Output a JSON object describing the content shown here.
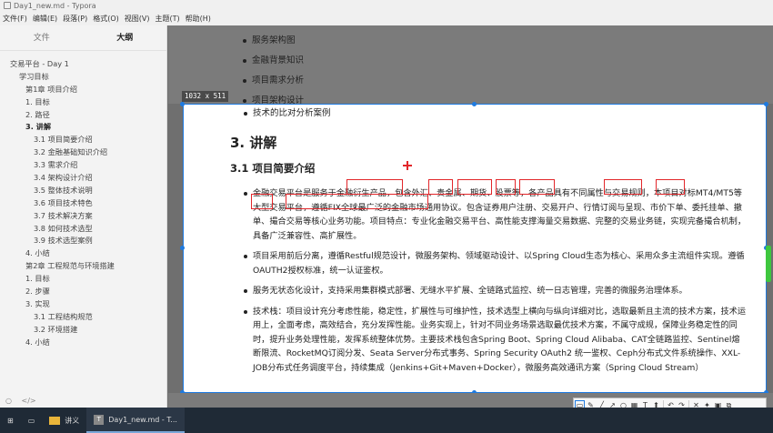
{
  "window": {
    "title": "Day1_new.md - Typora"
  },
  "menu": [
    "文件(F)",
    "编辑(E)",
    "段落(P)",
    "格式(O)",
    "视图(V)",
    "主题(T)",
    "帮助(H)"
  ],
  "sidebar": {
    "tabs": [
      "文件",
      "大纲"
    ],
    "active_tab": "大纲",
    "outline": [
      {
        "label": "交易平台 - Day 1",
        "level": 0
      },
      {
        "label": "学习目标",
        "level": 1
      },
      {
        "label": "第1章 项目介绍",
        "level": 2
      },
      {
        "label": "1. 目标",
        "level": 2
      },
      {
        "label": "2. 路径",
        "level": 2
      },
      {
        "label": "3. 讲解",
        "level": 2,
        "bold": true
      },
      {
        "label": "3.1 项目简要介绍",
        "level": 3
      },
      {
        "label": "3.2 金融基础知识介绍",
        "level": 3
      },
      {
        "label": "3.3 需求介绍",
        "level": 3
      },
      {
        "label": "3.4 架构设计介绍",
        "level": 3
      },
      {
        "label": "3.5 整体技术说明",
        "level": 3
      },
      {
        "label": "3.6 项目技术特色",
        "level": 3
      },
      {
        "label": "3.7 技术解决方案",
        "level": 3
      },
      {
        "label": "3.8 如何技术选型",
        "level": 3
      },
      {
        "label": "3.9 技术选型案例",
        "level": 3
      },
      {
        "label": "4. 小结",
        "level": 2
      },
      {
        "label": "第2章 工程规范与环境搭建",
        "level": 2
      },
      {
        "label": "1. 目标",
        "level": 2
      },
      {
        "label": "2. 步骤",
        "level": 2
      },
      {
        "label": "3. 实现",
        "level": 2
      },
      {
        "label": "3.1 工程结构规范",
        "level": 3
      },
      {
        "label": "3.2 环境搭建",
        "level": 3
      },
      {
        "label": "4. 小结",
        "level": 2
      }
    ],
    "footer": [
      "○",
      "</>"
    ]
  },
  "editor": {
    "top_bullets": [
      "服务架构图",
      "金融背景知识",
      "项目需求分析",
      "项目架构设计"
    ],
    "selection_size": "1032 x 511",
    "bullet_first": "技术的比对分析案例",
    "h2": "3. 讲解",
    "h3": "3.1 项目简要介绍",
    "paragraphs": [
      "金融交易平台是服务于金融衍生产品，包含外汇、贵金属、期货、股票等，各产品具有不同属性与交易规则，本项目对标MT4/MT5等大型交易平台，遵循FIX全球最广泛的金融市场通用协议。包含证券用户注册、交易开户、行情订阅与呈现、市价下单、委托挂单、撤单、撮合交易等核心业务功能。项目特点：专业化金融交易平台、高性能支撑海量交易数据、完整的交易业务链，实现完备撮合机制，具备广泛兼容性、高扩展性。",
      "项目采用前后分离，遵循Restful规范设计，微服务架构、领域驱动设计、以Spring Cloud生态为核心、采用众多主流组件实现。遵循OAUTH2授权标准，统一认证鉴权。",
      "服务无状态化设计，支持采用集群模式部署、无缝水平扩展、全链路式监控、统一日志管理，完善的微服务治理体系。",
      "技术栈：项目设计充分考虑性能，稳定性，扩展性与可维护性，技术选型上横向与纵向详细对比，选取最新且主流的技术方案，技术运用上，全面考虑，高效结合，充分发挥性能。业务实现上，针对不同业务场景选取最优技术方案，不属守成规，保障业务稳定性的同时，提升业务处理性能，发挥系统整体优势。主要技术栈包含Spring Boot、Spring Cloud Alibaba、CAT全链路监控、Sentinel熔断限流、RocketMQ订阅分发、Seata Server分布式事务、Spring Security OAuth2 统一鉴权、Ceph分布式文件系统操作、XXL-JOB分布式任务调度平台，持续集成（Jenkins+Git+Maven+Docker），微服务高效通讯方案（Spring Cloud Stream）"
    ]
  },
  "toolbar": {
    "tools": [
      "rect-select",
      "pen",
      "line",
      "arrow",
      "mosaic",
      "text",
      "undo",
      "redo",
      "close",
      "pin",
      "save",
      "copy"
    ],
    "colors": [
      "#000000",
      "#7f7f7f",
      "#880015",
      "#ed1c24",
      "#ff7f27",
      "#fff200",
      "#22b14c",
      "#00a2e8",
      "#3f48cc",
      "#a349a4",
      "#ffffff",
      "#c3c3c3",
      "#b97a57",
      "#ffaec9",
      "#ffc90e",
      "#efe4b0",
      "#b5e61d",
      "#99d9ea"
    ],
    "current_color": "#e2262a"
  },
  "taskbar": {
    "items": [
      "讲义",
      "Day1_new.md - T..."
    ]
  }
}
